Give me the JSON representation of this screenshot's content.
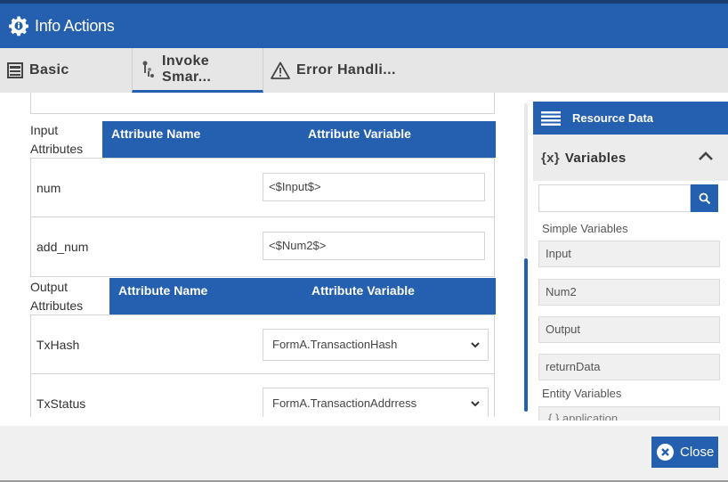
{
  "dialog": {
    "title": "Info Actions"
  },
  "tabs": [
    {
      "label": "Basic"
    },
    {
      "label": "Invoke Smar..."
    },
    {
      "label": "Error Handli..."
    }
  ],
  "input_section": {
    "label_line1": "Input",
    "label_line2": "Attributes",
    "col_name": "Attribute Name",
    "col_var": "Attribute Variable",
    "rows": [
      {
        "name": "num",
        "value": "<$Input$>"
      },
      {
        "name": "add_num",
        "value": "<$Num2$>"
      }
    ]
  },
  "output_section": {
    "label_line1": "Output",
    "label_line2": "Attributes",
    "col_name": "Attribute Name",
    "col_var": "Attribute Variable",
    "rows": [
      {
        "name": "TxHash",
        "value": "FormA.TransactionHash"
      },
      {
        "name": "TxStatus",
        "value": "FormA.TransactionAddrress"
      }
    ]
  },
  "resource_panel": {
    "title": "Resource Data",
    "variables_title": "Variables",
    "variables_prefix": "{x}",
    "search_placeholder": "",
    "simple_label": "Simple Variables",
    "simple_vars": [
      "Input",
      "Num2",
      "Output",
      "returnData"
    ],
    "entity_label": "Entity Variables",
    "entity_vars": [
      "{ } application"
    ]
  },
  "footer": {
    "close_label": "Close"
  },
  "colors": {
    "primary": "#2560b0",
    "header_dark": "#1c3f73"
  }
}
